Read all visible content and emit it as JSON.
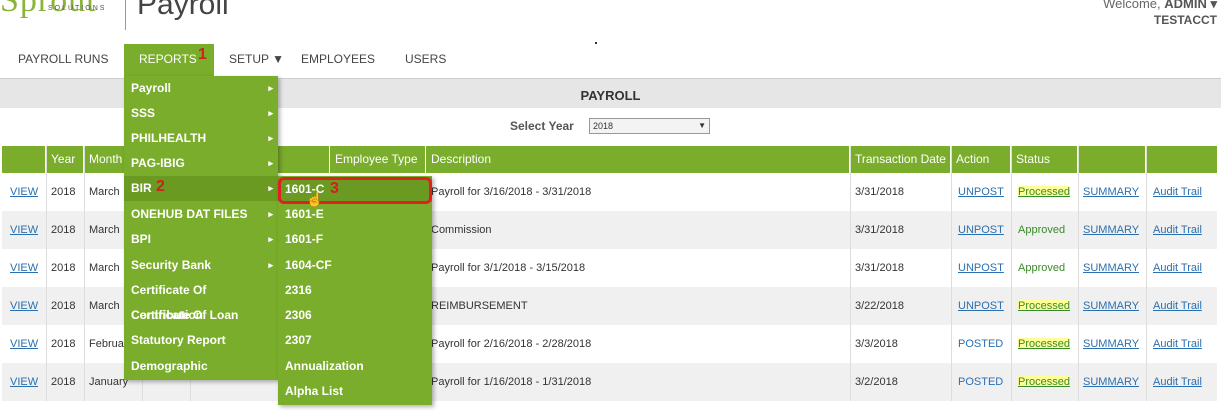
{
  "header": {
    "logo_word": "Sprout",
    "logo_sub": "SOLUTIONS",
    "app_title": "Payroll",
    "welcome_prefix": "Welcome, ",
    "welcome_user": "ADMIN ▾",
    "account": "TESTACCT"
  },
  "nav": {
    "items": [
      "PAYROLL RUNS",
      "REPORTS",
      "SETUP ▼",
      "EMPLOYEES",
      "USERS"
    ]
  },
  "page": {
    "title": "PAYROLL",
    "select_label": "Select Year",
    "year_value": "2018",
    "select_arrow": "▼"
  },
  "table": {
    "headers": [
      "",
      "Year",
      "Month",
      "",
      "",
      "Employee Type",
      "Description",
      "Transaction Date",
      "Action",
      "Status",
      "",
      ""
    ],
    "rows": [
      {
        "view": "VIEW",
        "year": "2018",
        "month": "March",
        "description": "Payroll for 3/16/2018 - 3/31/2018",
        "date": "3/31/2018",
        "action": "UNPOST",
        "status": "Processed",
        "summary": "SUMMARY",
        "audit": "Audit Trail"
      },
      {
        "view": "VIEW",
        "year": "2018",
        "month": "March",
        "description": "Commission",
        "date": "3/31/2018",
        "action": "UNPOST",
        "status": "Approved",
        "summary": "SUMMARY",
        "audit": "Audit Trail"
      },
      {
        "view": "VIEW",
        "year": "2018",
        "month": "March",
        "description": "Payroll for 3/1/2018 - 3/15/2018",
        "date": "3/31/2018",
        "action": "UNPOST",
        "status": "Approved",
        "summary": "SUMMARY",
        "audit": "Audit Trail"
      },
      {
        "view": "VIEW",
        "year": "2018",
        "month": "March",
        "description": "REIMBURSEMENT",
        "date": "3/22/2018",
        "action": "UNPOST",
        "status": "Processed",
        "summary": "SUMMARY",
        "audit": "Audit Trail"
      },
      {
        "view": "VIEW",
        "year": "2018",
        "month": "Februa",
        "description": "Payroll for 2/16/2018 - 2/28/2018",
        "date": "3/3/2018",
        "action": "POSTED",
        "status": "Processed",
        "summary": "SUMMARY",
        "audit": "Audit Trail"
      },
      {
        "view": "VIEW",
        "year": "2018",
        "month": "January",
        "description": "Payroll for 1/16/2018 - 1/31/2018",
        "date": "3/2/2018",
        "action": "POSTED",
        "status": "Processed",
        "summary": "SUMMARY",
        "audit": "Audit Trail"
      }
    ]
  },
  "reports_menu": {
    "items": [
      "Payroll",
      "SSS",
      "PHILHEALTH",
      "PAG-IBIG",
      "BIR",
      "ONEHUB DAT FILES",
      "BPI",
      "Security Bank",
      "Certificate Of Contribution",
      "Certificate Of Loan",
      "Statutory Report",
      "Demographic"
    ],
    "submenu_caret": "▸"
  },
  "bir_menu": {
    "items": [
      "1601-C",
      "1601-E",
      "1601-F",
      "1604-CF",
      "2316",
      "2306",
      "2307",
      "Annualization",
      "Alpha List"
    ]
  },
  "annotations": {
    "step1": "1",
    "step2": "2",
    "step3": "3",
    "cursor": "☝"
  },
  "colors": {
    "accent_green": "#7aad2b",
    "highlight_red": "#e02020"
  }
}
